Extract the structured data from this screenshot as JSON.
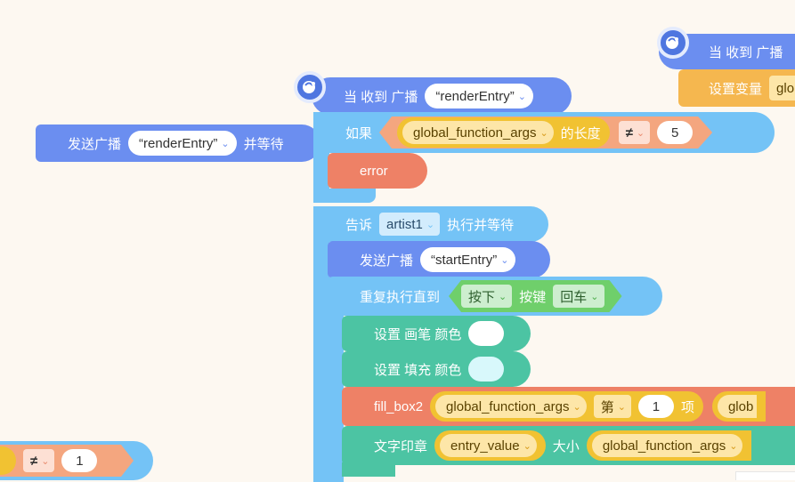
{
  "top_right_hat": {
    "label": "当 收到 广播",
    "set_var_label": "设置变量",
    "var_fragment": "glo"
  },
  "send_wait_block": {
    "prefix": "发送广播",
    "value": "“renderEntry”",
    "suffix": "并等待"
  },
  "main_hat": {
    "label": "当 收到 广播",
    "value": "“renderEntry”"
  },
  "if_block": {
    "label": "如果",
    "var": "global_function_args",
    "length_label": "的长度",
    "op": "≠",
    "number": "5"
  },
  "error_block": {
    "label": "error"
  },
  "tell_block": {
    "prefix": "告诉",
    "target": "artist1",
    "suffix": "执行并等待"
  },
  "send_block": {
    "prefix": "发送广播",
    "value": "“startEntry”"
  },
  "repeat_block": {
    "label": "重复执行直到",
    "cond_press": "按下",
    "cond_key_label": "按键",
    "cond_key": "回车"
  },
  "pen_color_block": {
    "label": "设置 画笔 颜色",
    "color": "#ffffff"
  },
  "fill_color_block": {
    "label": "设置 填充 颜色",
    "color": "#d8f8fb"
  },
  "fill_box_block": {
    "label": "fill_box2",
    "var": "global_function_args",
    "index_prefix": "第",
    "index": "1",
    "index_suffix": "项",
    "trailing": "glob"
  },
  "stamp_block": {
    "label": "文字印章",
    "value": "entry_value",
    "size_label": "大小",
    "var": "global_function_args"
  },
  "bottom_left_fragment": {
    "op": "≠",
    "number": "1"
  },
  "colors": {
    "hat_blue": "#6b8ef0",
    "control_blue": "#74c3f6",
    "pen_teal": "#4cc4a3",
    "func_coral": "#ee8166",
    "var_orange": "#f5b74f",
    "sense_green": "#6fcf6b"
  }
}
